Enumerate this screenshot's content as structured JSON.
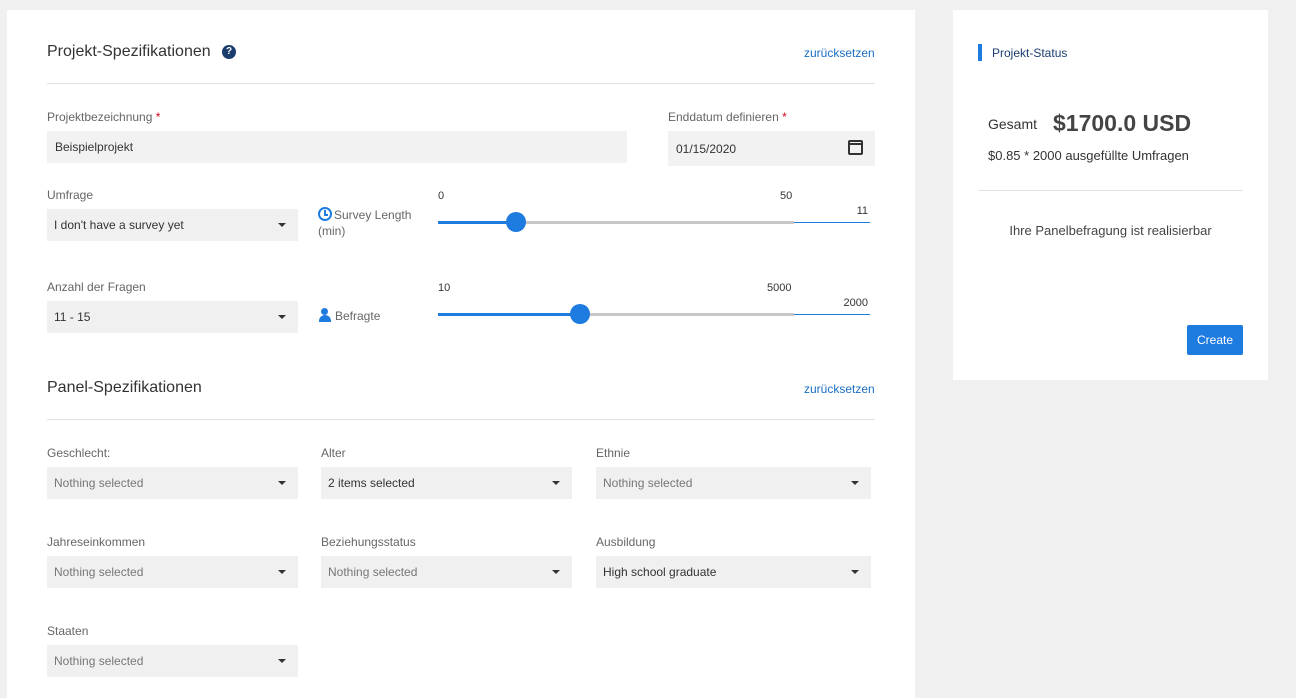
{
  "project_specs": {
    "title": "Projekt-Spezifikationen",
    "help_icon": "question-circle-icon",
    "reset_label": "zurücksetzen",
    "project_name": {
      "label": "Projektbezeichnung",
      "value": "Beispielprojekt"
    },
    "end_date": {
      "label": "Enddatum definieren",
      "value": "01/15/2020",
      "icon": "calendar-icon"
    },
    "required_marker": "*",
    "survey": {
      "label": "Umfrage",
      "value": "I don't have a survey yet"
    },
    "survey_length": {
      "label": "Survey Length (min)",
      "icon": "clock-icon",
      "min_label": "0",
      "max_label": "50",
      "min": 0,
      "max": 50,
      "value": "11"
    },
    "questions": {
      "label": "Anzahl der Fragen",
      "value": "11 - 15"
    },
    "respondents": {
      "label": "Befragte",
      "icon": "person-icon",
      "min_label": "10",
      "max_label": "5000",
      "min": 10,
      "max": 5000,
      "value": "2000"
    }
  },
  "panel_specs": {
    "title": "Panel-Spezifikationen",
    "reset_label": "zurücksetzen",
    "gender": {
      "label": "Geschlecht:",
      "value": "Nothing selected"
    },
    "age": {
      "label": "Alter",
      "value": "2 items selected"
    },
    "ethnicity": {
      "label": "Ethnie",
      "value": "Nothing selected"
    },
    "income": {
      "label": "Jahreseinkommen",
      "value": "Nothing selected"
    },
    "relationship": {
      "label": "Beziehungsstatus",
      "value": "Nothing selected"
    },
    "education": {
      "label": "Ausbildung",
      "value": "High school graduate"
    },
    "states": {
      "label": "Staaten",
      "value": "Nothing selected"
    }
  },
  "status": {
    "title": "Projekt-Status",
    "total_label": "Gesamt",
    "total_value": "$1700.0 USD",
    "breakdown": "$0.85 * 2000 ausgefüllte Umfragen",
    "feasibility": "Ihre Panelbefragung ist realisierbar",
    "create_label": "Create"
  },
  "colors": {
    "accent": "#1e7be0",
    "link": "#1a6fc4",
    "required": "#d0021b"
  }
}
